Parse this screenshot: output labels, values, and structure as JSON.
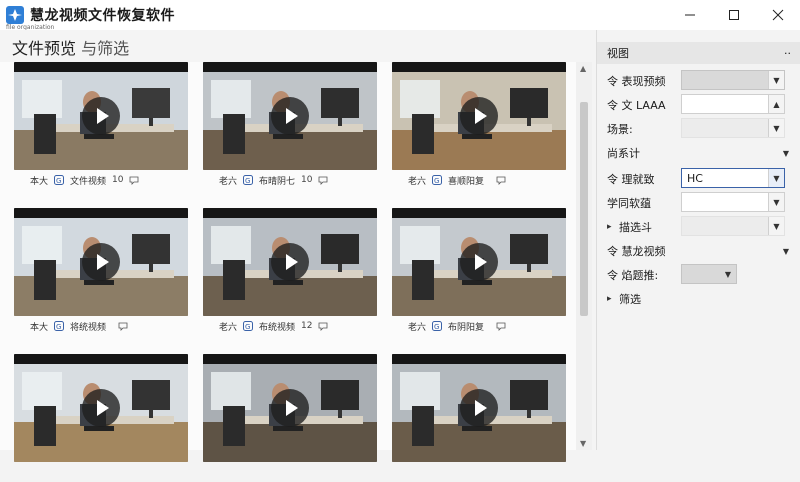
{
  "window": {
    "title": "慧龙视频文件恢复软件",
    "subtitle": "file organization"
  },
  "page": {
    "title_strong": "文件预览",
    "title_light": " 与筛选"
  },
  "cards": [
    {
      "type": "本大",
      "name": "文件视频",
      "count": "10"
    },
    {
      "type": "老六",
      "name": "布晴阴七",
      "count": "10"
    },
    {
      "type": "老六",
      "name": "喜顺阳复",
      "count": ""
    },
    {
      "type": "本大",
      "name": "将统视频",
      "count": ""
    },
    {
      "type": "老六",
      "name": "布统视频",
      "count": "12"
    },
    {
      "type": "老六",
      "name": "布阴阳复",
      "count": ""
    },
    {
      "type": "",
      "name": "",
      "count": ""
    },
    {
      "type": "",
      "name": "",
      "count": ""
    },
    {
      "type": "",
      "name": "",
      "count": ""
    }
  ],
  "panel": {
    "header": "视图",
    "header_more": "··",
    "rows": [
      {
        "label": "令 表现预频",
        "value": ""
      },
      {
        "label": "令 文 LAAA",
        "value": ""
      },
      {
        "label": "场景:",
        "value": ""
      },
      {
        "label": "尚系计",
        "value": ""
      },
      {
        "label": "令 理就致",
        "value": "HC"
      },
      {
        "label": "学同软蕴",
        "value": ""
      },
      {
        "label": "描选斗",
        "value": ""
      },
      {
        "label": "令 慧龙视频",
        "value": ""
      },
      {
        "label": "令 焰题推:",
        "value": ""
      },
      {
        "label": "筛选",
        "value": ""
      }
    ]
  },
  "colors": {
    "accent": "#3a62a8",
    "titlebar_icon": "#2f7fd6"
  }
}
